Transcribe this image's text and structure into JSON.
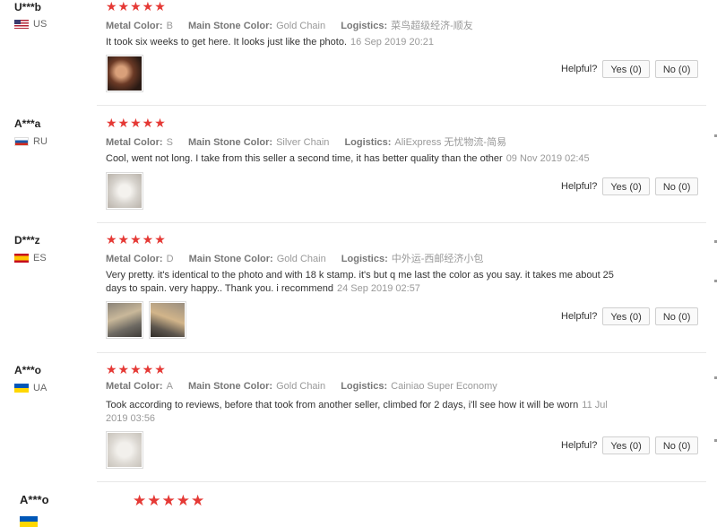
{
  "helpful_label": "Helpful?",
  "colors": {
    "star": "#e53935",
    "sep": "#e8e8e8"
  },
  "reviews": [
    {
      "user": "U***b",
      "country": "US",
      "stars": "★★★★★",
      "metal_key": "Metal Color:",
      "metal": "B",
      "stone_key": "Main Stone Color:",
      "stone": "Gold Chain",
      "log_key": "Logistics:",
      "logistics": "菜鸟超级经济-顺友",
      "text": "It took six weeks to get here. It looks just like the photo.",
      "date": "16 Sep 2019 20:21",
      "yes": "Yes (0)",
      "no": "No (0)"
    },
    {
      "user": "A***a",
      "country": "RU",
      "stars": "★★★★★",
      "metal_key": "Metal Color:",
      "metal": "S",
      "stone_key": "Main Stone Color:",
      "stone": "Silver Chain",
      "log_key": "Logistics:",
      "logistics": "AliExpress 无忧物流-简易",
      "text": "Cool, went not long. I take from this seller a second time, it has better quality than the other",
      "date": "09 Nov 2019 02:45",
      "yes": "Yes (0)",
      "no": "No (0)"
    },
    {
      "user": "D***z",
      "country": "ES",
      "stars": "★★★★★",
      "metal_key": "Metal Color:",
      "metal": "D",
      "stone_key": "Main Stone Color:",
      "stone": "Gold Chain",
      "log_key": "Logistics:",
      "logistics": "中外运-西邮经济小包",
      "text": "Very pretty. it's identical to the photo and with 18 k stamp. it's but q me last the color as you say. it takes me about 25 days to spain. very happy.. Thank you. i recommend",
      "date": "24 Sep 2019 02:57",
      "yes": "Yes (0)",
      "no": "No (0)"
    },
    {
      "user": "A***o",
      "country": "UA",
      "stars": "★★★★★",
      "metal_key": "Metal Color:",
      "metal": "A",
      "stone_key": "Main Stone Color:",
      "stone": "Gold Chain",
      "log_key": "Logistics:",
      "logistics": "Cainiao Super Economy",
      "text": "Took according to reviews, before that took from another seller, climbed for 2 days, i'll see how it will be worn",
      "date": "11 Jul 2019 03:56",
      "yes": "Yes (0)",
      "no": "No (0)"
    },
    {
      "user": "A***o",
      "stars": "★★★★★"
    }
  ]
}
